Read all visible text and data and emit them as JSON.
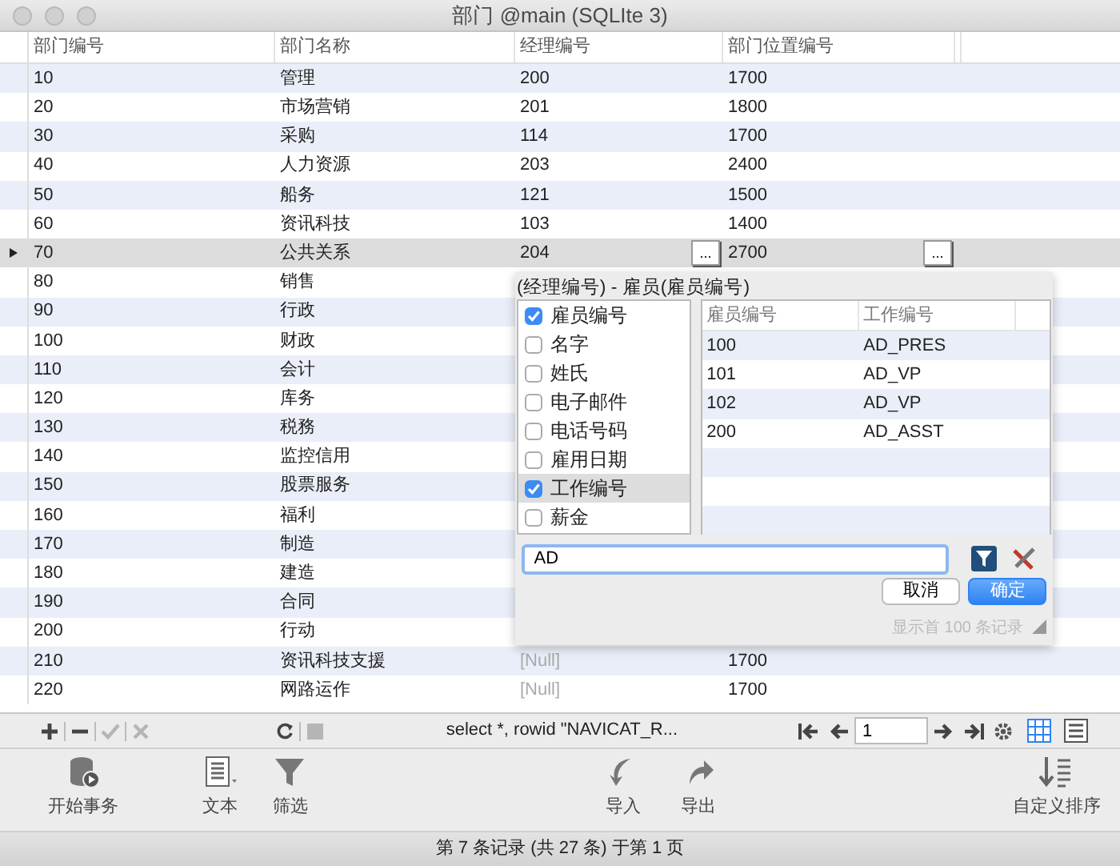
{
  "window": {
    "title": "部门 @main (SQLIte 3)"
  },
  "table": {
    "columns": [
      "部门编号",
      "部门名称",
      "经理编号",
      "部门位置编号"
    ],
    "rows": [
      {
        "cells": [
          "10",
          "管理",
          "200",
          "1700"
        ],
        "selected": false
      },
      {
        "cells": [
          "20",
          "市场营销",
          "201",
          "1800"
        ],
        "selected": false
      },
      {
        "cells": [
          "30",
          "采购",
          "114",
          "1700"
        ],
        "selected": false
      },
      {
        "cells": [
          "40",
          "人力资源",
          "203",
          "2400"
        ],
        "selected": false
      },
      {
        "cells": [
          "50",
          "船务",
          "121",
          "1500"
        ],
        "selected": false
      },
      {
        "cells": [
          "60",
          "资讯科技",
          "103",
          "1400"
        ],
        "selected": false
      },
      {
        "cells": [
          "70",
          "公共关系",
          "204",
          "2700"
        ],
        "selected": true,
        "cell_buttons": [
          "...",
          "..."
        ]
      },
      {
        "cells": [
          "80",
          "销售"
        ],
        "selected": false
      },
      {
        "cells": [
          "90",
          "行政"
        ],
        "selected": false
      },
      {
        "cells": [
          "100",
          "财政"
        ],
        "selected": false
      },
      {
        "cells": [
          "110",
          "会计"
        ],
        "selected": false
      },
      {
        "cells": [
          "120",
          "库务"
        ],
        "selected": false
      },
      {
        "cells": [
          "130",
          "税務"
        ],
        "selected": false
      },
      {
        "cells": [
          "140",
          "监控信用"
        ],
        "selected": false
      },
      {
        "cells": [
          "150",
          "股票服务"
        ],
        "selected": false
      },
      {
        "cells": [
          "160",
          "福利"
        ],
        "selected": false
      },
      {
        "cells": [
          "170",
          "制造"
        ],
        "selected": false
      },
      {
        "cells": [
          "180",
          "建造"
        ],
        "selected": false
      },
      {
        "cells": [
          "190",
          "合同"
        ],
        "selected": false
      },
      {
        "cells": [
          "200",
          "行动"
        ],
        "selected": false
      },
      {
        "cells": [
          "210",
          "资讯科技支援",
          {
            "text": "[Null]",
            "null": true
          },
          "1700"
        ],
        "selected": false
      },
      {
        "cells": [
          "220",
          "网路运作",
          {
            "text": "[Null]",
            "null": true
          },
          "1700"
        ],
        "selected": false
      }
    ]
  },
  "popup": {
    "title": "(经理编号) - 雇员(雇员编号)",
    "fields": [
      {
        "label": "雇员编号",
        "checked": true,
        "selected": false
      },
      {
        "label": "名字",
        "checked": false,
        "selected": false
      },
      {
        "label": "姓氏",
        "checked": false,
        "selected": false
      },
      {
        "label": "电子邮件",
        "checked": false,
        "selected": false
      },
      {
        "label": "电话号码",
        "checked": false,
        "selected": false
      },
      {
        "label": "雇用日期",
        "checked": false,
        "selected": false
      },
      {
        "label": "工作编号",
        "checked": true,
        "selected": true
      },
      {
        "label": "薪金",
        "checked": false,
        "selected": false
      }
    ],
    "grid": {
      "columns": [
        "雇员编号",
        "工作编号"
      ],
      "rows": [
        [
          "100",
          "AD_PRES"
        ],
        [
          "101",
          "AD_VP"
        ],
        [
          "102",
          "AD_VP"
        ],
        [
          "200",
          "AD_ASST"
        ]
      ]
    },
    "search": {
      "value": "AD"
    },
    "buttons": [
      {
        "label": "取消",
        "primary": false
      },
      {
        "label": "确定",
        "primary": true
      }
    ],
    "note": "显示首 100 条记录"
  },
  "toolbar": {
    "edit_buttons": [
      {
        "kind": "add",
        "disabled": false
      },
      {
        "kind": "remove",
        "disabled": false
      },
      {
        "kind": "apply",
        "disabled": true
      },
      {
        "kind": "discard",
        "disabled": true
      },
      {
        "kind": "refresh",
        "disabled": false
      },
      {
        "kind": "stop",
        "disabled": true
      }
    ],
    "sql": "select *, rowid \"NAVICAT_R...",
    "page": "1",
    "views": [
      {
        "kind": "grid",
        "selected": true
      },
      {
        "kind": "form",
        "selected": false
      }
    ]
  },
  "main_toolbar": [
    {
      "kind": "transaction",
      "label": "开始事务"
    },
    {
      "kind": "text",
      "label": "文本"
    },
    {
      "kind": "filter",
      "label": "筛选"
    },
    {
      "kind": "import",
      "label": "导入"
    },
    {
      "kind": "export",
      "label": "导出"
    },
    {
      "kind": "sort",
      "label": "自定义排序"
    }
  ],
  "status_bar": "第 7 条记录 (共 27 条) 于第 1 页"
}
